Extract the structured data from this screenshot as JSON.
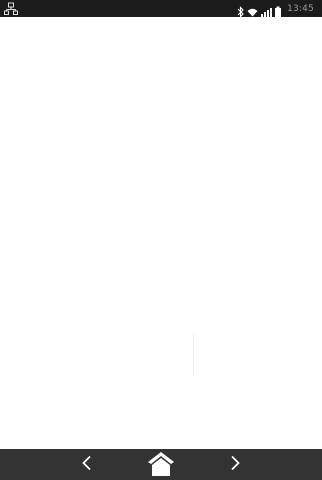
{
  "status_bar": {
    "left_icon": "network-icon",
    "icons": [
      "bluetooth-icon",
      "wifi-icon",
      "signal-icon",
      "battery-icon"
    ],
    "time": "13:45"
  },
  "nav_bar": {
    "buttons": [
      "back-icon",
      "home-icon",
      "forward-icon"
    ]
  },
  "colors": {
    "status_bar_bg": "#1b1b1b",
    "nav_bar_bg": "#333333",
    "content_bg": "#ffffff",
    "icon_color": "#ffffff",
    "clock_color": "#9a9a9a"
  }
}
